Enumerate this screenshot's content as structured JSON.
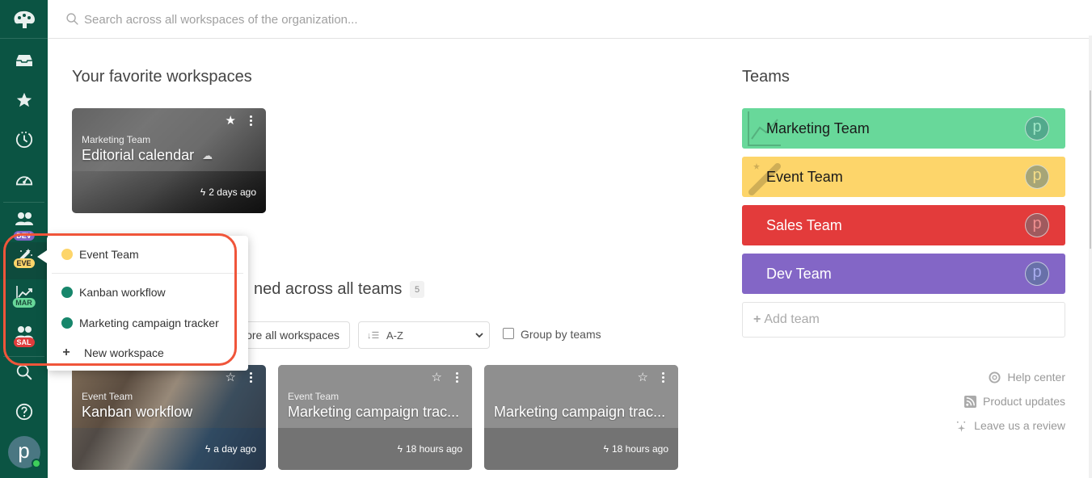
{
  "header": {
    "search_placeholder": "Search across all workspaces of the organization..."
  },
  "sidebar": {
    "items": [
      {
        "name": "inbox",
        "icon": "inbox-icon"
      },
      {
        "name": "favorites",
        "icon": "star-icon"
      },
      {
        "name": "recent",
        "icon": "clock-icon"
      },
      {
        "name": "dashboard",
        "icon": "gauge-icon"
      }
    ],
    "teams": [
      {
        "badge": "DEV",
        "icon": "team-users-icon",
        "color": "#7e63c6"
      },
      {
        "badge": "EVE",
        "icon": "magic-wand-icon",
        "color": "#fdd56a"
      },
      {
        "badge": "MAR",
        "icon": "chart-line-icon",
        "color": "#68d89a"
      },
      {
        "badge": "SAL",
        "icon": "team-users-icon",
        "color": "#e13c3c"
      }
    ],
    "avatar_letter": "p"
  },
  "favorites": {
    "title": "Your favorite workspaces",
    "cards": [
      {
        "team": "Marketing Team",
        "title": "Editorial calendar",
        "time": "2 days ago",
        "starred": true
      }
    ]
  },
  "all_workspaces": {
    "title_visible": "ned across all teams",
    "count": "5",
    "explore_label": "ore all workspaces",
    "sort_value": "A-Z",
    "group_label": "Group by teams",
    "group_checked": false,
    "cards": [
      {
        "team": "Event Team",
        "title": "Kanban workflow",
        "time": "a day ago",
        "starred": false
      },
      {
        "team": "Event Team",
        "title": "Marketing campaign trac...",
        "time": "18 hours ago",
        "starred": false
      },
      {
        "team": "",
        "title": "Marketing campaign trac...",
        "time": "18 hours ago",
        "starred": false
      }
    ]
  },
  "popup": {
    "team": {
      "label": "Event Team",
      "color": "#fdd56a"
    },
    "workspaces": [
      {
        "label": "Kanban workflow",
        "color": "#17866b"
      },
      {
        "label": "Marketing campaign tracker",
        "color": "#17866b"
      }
    ],
    "new_label": "New workspace"
  },
  "teams": {
    "title": "Teams",
    "list": [
      {
        "name": "Marketing Team",
        "color": "#68d89a",
        "text_color": "#1a1a1a",
        "avatar": "p"
      },
      {
        "name": "Event Team",
        "color": "#fdd56a",
        "text_color": "#1a1a1a",
        "avatar": "p"
      },
      {
        "name": "Sales Team",
        "color": "#e33b3b",
        "text_color": "#ffffff",
        "avatar": "p"
      },
      {
        "name": "Dev Team",
        "color": "#8366c6",
        "text_color": "#ffffff",
        "avatar": "p"
      }
    ],
    "add_label": "Add team"
  },
  "footer_links": {
    "help": "Help center",
    "updates": "Product updates",
    "review": "Leave us a review"
  }
}
